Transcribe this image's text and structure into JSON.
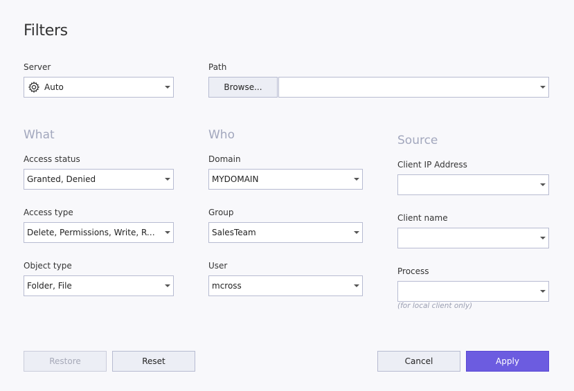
{
  "dialog": {
    "title": "Filters"
  },
  "server": {
    "label": "Server",
    "value": "Auto",
    "icon": "gear-icon"
  },
  "path": {
    "label": "Path",
    "browse_label": "Browse...",
    "value": ""
  },
  "what": {
    "heading": "What",
    "access_status": {
      "label": "Access status",
      "value": "Granted, Denied"
    },
    "access_type": {
      "label": "Access type",
      "value": "Delete, Permissions, Write, Rea..."
    },
    "object_type": {
      "label": "Object type",
      "value": "Folder, File"
    }
  },
  "who": {
    "heading": "Who",
    "domain": {
      "label": "Domain",
      "value": "MYDOMAIN"
    },
    "group": {
      "label": "Group",
      "value": "SalesTeam"
    },
    "user": {
      "label": "User",
      "value": "mcross"
    }
  },
  "source": {
    "heading": "Source",
    "client_ip": {
      "label": "Client IP Address",
      "value": ""
    },
    "client_name": {
      "label": "Client name",
      "value": ""
    },
    "process": {
      "label": "Process",
      "value": "",
      "hint": "(for local client only)"
    }
  },
  "buttons": {
    "restore": "Restore",
    "reset": "Reset",
    "cancel": "Cancel",
    "apply": "Apply"
  },
  "colors": {
    "accent": "#6c5ce0",
    "section_heading": "#a2a7bd",
    "border": "#b7bbd1",
    "background": "#f8f8fb"
  }
}
